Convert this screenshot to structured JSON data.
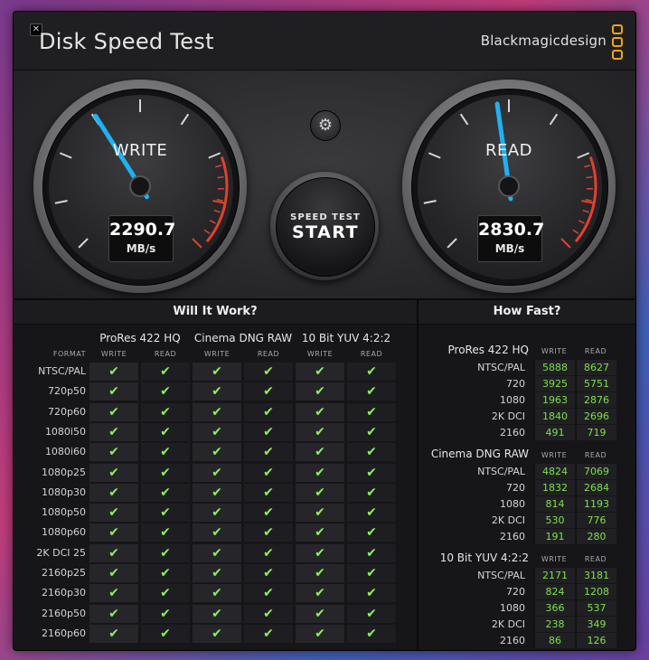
{
  "window": {
    "title": "Disk Speed Test",
    "brand": "Blackmagicdesign",
    "close_glyph": "✕",
    "brand_color": "#f2a31b"
  },
  "gauges": {
    "write": {
      "label": "WRITE",
      "value": "2290.7",
      "unit": "MB/s",
      "level": 0.38
    },
    "read": {
      "label": "READ",
      "value": "2830.7",
      "unit": "MB/s",
      "level": 0.47
    }
  },
  "controls": {
    "settings_icon": "gear-icon",
    "settings_glyph": "⚙",
    "start_line1": "SPEED TEST",
    "start_line2": "START"
  },
  "will_it_work": {
    "title": "Will It Work?",
    "format_header": "FORMAT",
    "groups": [
      {
        "name": "ProRes 422 HQ",
        "sub": [
          "WRITE",
          "READ"
        ]
      },
      {
        "name": "Cinema DNG RAW",
        "sub": [
          "WRITE",
          "READ"
        ]
      },
      {
        "name": "10 Bit YUV 4:2:2",
        "sub": [
          "WRITE",
          "READ"
        ]
      }
    ],
    "check_glyph": "✔",
    "check_color": "#8df05d",
    "rows": [
      "NTSC/PAL",
      "720p50",
      "720p60",
      "1080i50",
      "1080i60",
      "1080p25",
      "1080p30",
      "1080p50",
      "1080p60",
      "2K DCI 25",
      "2160p25",
      "2160p30",
      "2160p50",
      "2160p60"
    ]
  },
  "how_fast": {
    "title": "How Fast?",
    "sub": [
      "WRITE",
      "READ"
    ],
    "value_color": "#7ee04a",
    "groups": [
      {
        "name": "ProRes 422 HQ",
        "rows": [
          {
            "label": "NTSC/PAL",
            "write": "5888",
            "read": "8627"
          },
          {
            "label": "720",
            "write": "3925",
            "read": "5751"
          },
          {
            "label": "1080",
            "write": "1963",
            "read": "2876"
          },
          {
            "label": "2K DCI",
            "write": "1840",
            "read": "2696"
          },
          {
            "label": "2160",
            "write": "491",
            "read": "719"
          }
        ]
      },
      {
        "name": "Cinema DNG RAW",
        "rows": [
          {
            "label": "NTSC/PAL",
            "write": "4824",
            "read": "7069"
          },
          {
            "label": "720",
            "write": "1832",
            "read": "2684"
          },
          {
            "label": "1080",
            "write": "814",
            "read": "1193"
          },
          {
            "label": "2K DCI",
            "write": "530",
            "read": "776"
          },
          {
            "label": "2160",
            "write": "191",
            "read": "280"
          }
        ]
      },
      {
        "name": "10 Bit YUV 4:2:2",
        "rows": [
          {
            "label": "NTSC/PAL",
            "write": "2171",
            "read": "3181"
          },
          {
            "label": "720",
            "write": "824",
            "read": "1208"
          },
          {
            "label": "1080",
            "write": "366",
            "read": "537"
          },
          {
            "label": "2K DCI",
            "write": "238",
            "read": "349"
          },
          {
            "label": "2160",
            "write": "86",
            "read": "126"
          }
        ]
      }
    ]
  }
}
